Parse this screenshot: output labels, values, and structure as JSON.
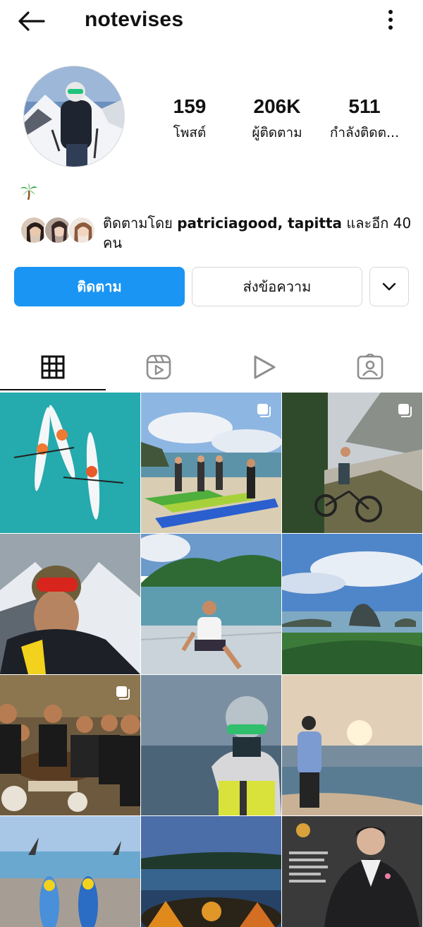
{
  "header": {
    "username": "notevises",
    "back_icon": "arrow-left-icon",
    "menu_icon": "more-vertical-icon"
  },
  "profile": {
    "stats": [
      {
        "value": "159",
        "label": "โพสต์"
      },
      {
        "value": "206K",
        "label": "ผู้ติดตาม"
      },
      {
        "value": "511",
        "label": "กำลังติดต..."
      }
    ],
    "bio_emoji": "🌴",
    "followed_by": {
      "prefix": "ติดตามโดย ",
      "users": "patriciagood, tapitta",
      "suffix": " และอีก 40 คน"
    }
  },
  "actions": {
    "follow_label": "ติดตาม",
    "message_label": "ส่งข้อความ",
    "dropdown_icon": "chevron-down-icon"
  },
  "tabs": [
    {
      "name": "posts",
      "icon": "grid-icon",
      "active": true
    },
    {
      "name": "reels",
      "icon": "reels-icon",
      "active": false
    },
    {
      "name": "videos",
      "icon": "play-icon",
      "active": false
    },
    {
      "name": "tagged",
      "icon": "tagged-person-icon",
      "active": false
    }
  ],
  "colors": {
    "accent": "#1a95f3",
    "border": "#d8d8d8"
  },
  "grid_posts": [
    {
      "subject": "kayaks-on-turquoise-sea",
      "multi": false
    },
    {
      "subject": "group-with-paddles-on-beach",
      "multi": true
    },
    {
      "subject": "cyclist-by-mountain",
      "multi": true
    },
    {
      "subject": "selfie-snow-mountains",
      "multi": false
    },
    {
      "subject": "man-sitting-on-dock",
      "multi": false
    },
    {
      "subject": "bay-with-limestone-islands",
      "multi": false
    },
    {
      "subject": "group-dinner",
      "multi": true
    },
    {
      "subject": "masked-man-on-sea",
      "multi": false
    },
    {
      "subject": "man-at-sunset-beach",
      "multi": false
    },
    {
      "subject": "kayaks-on-shore",
      "multi": false
    },
    {
      "subject": "campfire-at-dusk",
      "multi": false
    },
    {
      "subject": "portrait-poster",
      "multi": false
    }
  ]
}
